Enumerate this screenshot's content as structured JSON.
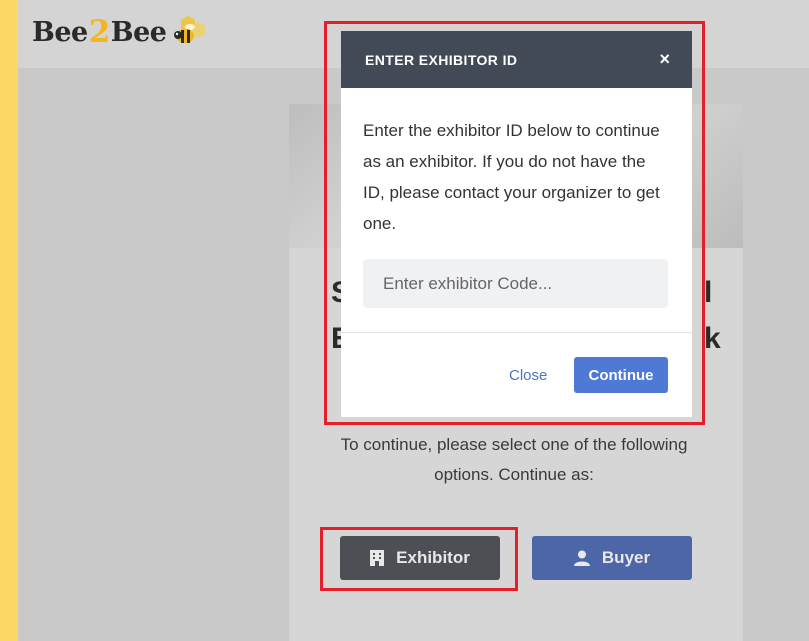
{
  "header": {
    "logo_part1": "Bee",
    "logo_part2": "2",
    "logo_part3": "Bee"
  },
  "background_card": {
    "title_fragment_left_1": "S",
    "title_fragment_right_1": "l",
    "title_fragment_left_2": "E",
    "title_fragment_right_2": "k",
    "instructions": "To continue, please select one of the following options. Continue as:",
    "exhibitor_button": "Exhibitor",
    "buyer_button": "Buyer"
  },
  "modal": {
    "title": "ENTER EXHIBITOR ID",
    "close_glyph": "×",
    "message": "Enter the exhibitor ID below to continue as an exhibitor. If you do not have the ID, please contact your organizer to get one.",
    "input_placeholder": "Enter exhibitor Code...",
    "input_value": "",
    "close_link": "Close",
    "continue_button": "Continue"
  },
  "colors": {
    "page_border": "#fdd866",
    "modal_header": "#424a57",
    "primary": "#4e79d4",
    "highlight": "#e3202a"
  }
}
